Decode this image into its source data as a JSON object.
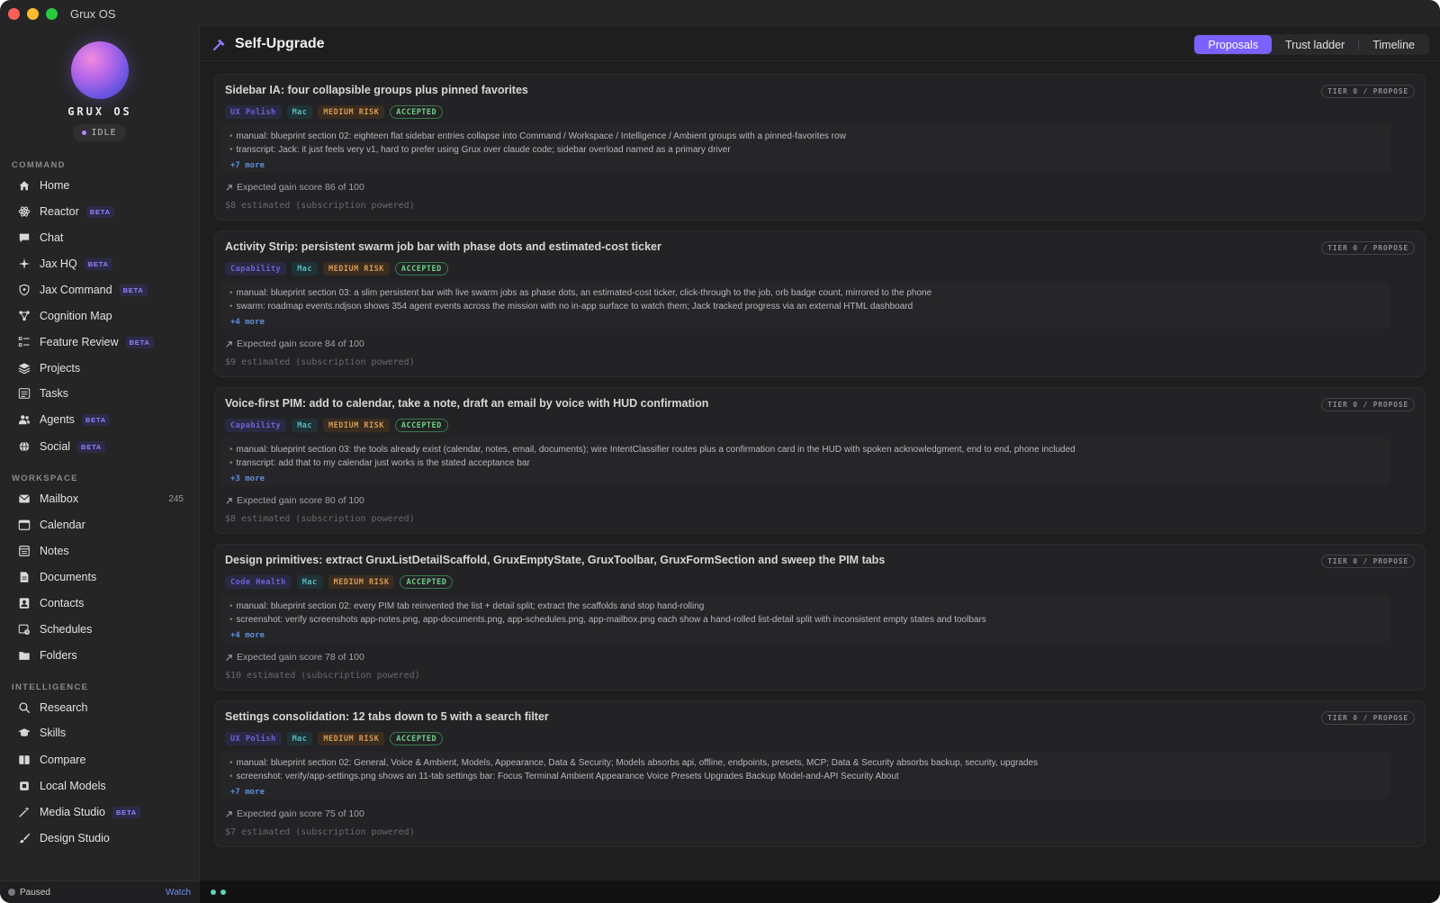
{
  "window": {
    "title": "Grux OS"
  },
  "sidebar": {
    "brand": "GRUX OS",
    "status": "IDLE",
    "sections": [
      {
        "label": "COMMAND",
        "items": [
          {
            "label": "Home",
            "icon": "house-icon"
          },
          {
            "label": "Reactor",
            "icon": "atom-icon",
            "badge": "BETA"
          },
          {
            "label": "Chat",
            "icon": "chat-bubble-icon"
          },
          {
            "label": "Jax HQ",
            "icon": "sparkle-icon",
            "badge": "BETA"
          },
          {
            "label": "Jax Command",
            "icon": "shield-icon",
            "badge": "BETA"
          },
          {
            "label": "Cognition Map",
            "icon": "graph-nodes-icon"
          },
          {
            "label": "Feature Review",
            "icon": "checklist-icon",
            "badge": "BETA"
          },
          {
            "label": "Projects",
            "icon": "layers-icon"
          },
          {
            "label": "Tasks",
            "icon": "task-list-icon"
          },
          {
            "label": "Agents",
            "icon": "people-icon",
            "badge": "BETA"
          },
          {
            "label": "Social",
            "icon": "globe-icon",
            "badge": "BETA"
          }
        ]
      },
      {
        "label": "WORKSPACE",
        "items": [
          {
            "label": "Mailbox",
            "icon": "envelope-icon",
            "count": "245"
          },
          {
            "label": "Calendar",
            "icon": "calendar-icon"
          },
          {
            "label": "Notes",
            "icon": "note-icon"
          },
          {
            "label": "Documents",
            "icon": "document-icon"
          },
          {
            "label": "Contacts",
            "icon": "contact-card-icon"
          },
          {
            "label": "Schedules",
            "icon": "schedule-icon"
          },
          {
            "label": "Folders",
            "icon": "folder-icon"
          }
        ]
      },
      {
        "label": "INTELLIGENCE",
        "items": [
          {
            "label": "Research",
            "icon": "magnifier-icon"
          },
          {
            "label": "Skills",
            "icon": "graduation-cap-icon"
          },
          {
            "label": "Compare",
            "icon": "split-view-icon"
          },
          {
            "label": "Local Models",
            "icon": "chip-icon"
          },
          {
            "label": "Media Studio",
            "icon": "magic-wand-icon",
            "badge": "BETA"
          },
          {
            "label": "Design Studio",
            "icon": "paintbrush-icon"
          }
        ]
      }
    ],
    "footer": {
      "status": "Paused",
      "action": "Watch"
    }
  },
  "header": {
    "title": "Self-Upgrade",
    "icon": "hammer-icon",
    "tabs": [
      {
        "label": "Proposals",
        "active": true
      },
      {
        "label": "Trust ladder",
        "active": false
      },
      {
        "label": "Timeline",
        "active": false
      }
    ]
  },
  "proposals": [
    {
      "title": "Sidebar IA: four collapsible groups plus pinned favorites",
      "tier": "TIER 0 / PROPOSE",
      "category": "UX Polish",
      "platform": "Mac",
      "risk": "MEDIUM RISK",
      "status": "ACCEPTED",
      "evidence": [
        "manual: blueprint section 02: eighteen flat sidebar entries collapse into Command / Workspace / Intelligence / Ambient groups with a pinned-favorites row",
        "transcript: Jack: it just feels very v1, hard to prefer using Grux over claude code; sidebar overload named as a primary driver"
      ],
      "more": "+7 more",
      "gain": "Expected gain score 86 of 100",
      "cost": "$8 estimated (subscription powered)"
    },
    {
      "title": "Activity Strip: persistent swarm job bar with phase dots and estimated-cost ticker",
      "tier": "TIER 0 / PROPOSE",
      "category": "Capability",
      "platform": "Mac",
      "risk": "MEDIUM RISK",
      "status": "ACCEPTED",
      "evidence": [
        "manual: blueprint section 03: a slim persistent bar with live swarm jobs as phase dots, an estimated-cost ticker, click-through to the job, orb badge count, mirrored to the phone",
        "swarm: roadmap events.ndjson shows 354 agent events across the mission with no in-app surface to watch them; Jack tracked progress via an external HTML dashboard"
      ],
      "more": "+4 more",
      "gain": "Expected gain score 84 of 100",
      "cost": "$9 estimated (subscription powered)"
    },
    {
      "title": "Voice-first PIM: add to calendar, take a note, draft an email by voice with HUD confirmation",
      "tier": "TIER 0 / PROPOSE",
      "category": "Capability",
      "platform": "Mac",
      "risk": "MEDIUM RISK",
      "status": "ACCEPTED",
      "evidence": [
        "manual: blueprint section 03: the tools already exist (calendar, notes, email, documents); wire IntentClassifier routes plus a confirmation card in the HUD with spoken acknowledgment, end to end, phone included",
        "transcript: add that to my calendar just works is the stated acceptance bar"
      ],
      "more": "+3 more",
      "gain": "Expected gain score 80 of 100",
      "cost": "$8 estimated (subscription powered)"
    },
    {
      "title": "Design primitives: extract GruxListDetailScaffold, GruxEmptyState, GruxToolbar, GruxFormSection and sweep the PIM tabs",
      "tier": "TIER 0 / PROPOSE",
      "category": "Code Health",
      "platform": "Mac",
      "risk": "MEDIUM RISK",
      "status": "ACCEPTED",
      "evidence": [
        "manual: blueprint section 02: every PIM tab reinvented the list + detail split; extract the scaffolds and stop hand-rolling",
        "screenshot: verify screenshots app-notes.png, app-documents.png, app-schedules.png, app-mailbox.png each show a hand-rolled list-detail split with inconsistent empty states and toolbars"
      ],
      "more": "+4 more",
      "gain": "Expected gain score 78 of 100",
      "cost": "$10 estimated (subscription powered)"
    },
    {
      "title": "Settings consolidation: 12 tabs down to 5 with a search filter",
      "tier": "TIER 0 / PROPOSE",
      "category": "UX Polish",
      "platform": "Mac",
      "risk": "MEDIUM RISK",
      "status": "ACCEPTED",
      "evidence": [
        "manual: blueprint section 02: General, Voice & Ambient, Models, Appearance, Data & Security; Models absorbs api, offline, endpoints, presets, MCP; Data & Security absorbs backup, security, upgrades",
        "screenshot: verify/app-settings.png shows an 11-tab settings bar: Focus Terminal Ambient Appearance Voice Presets Upgrades Backup Model-and-API Security About"
      ],
      "more": "+7 more",
      "gain": "Expected gain score 75 of 100",
      "cost": "$7 estimated (subscription powered)"
    }
  ],
  "colors": {
    "accent": "#7b61ff",
    "background": "#1e1e1e",
    "sidebar": "#252526",
    "accepted": "#6fcf89",
    "risk": "#d49a55"
  }
}
